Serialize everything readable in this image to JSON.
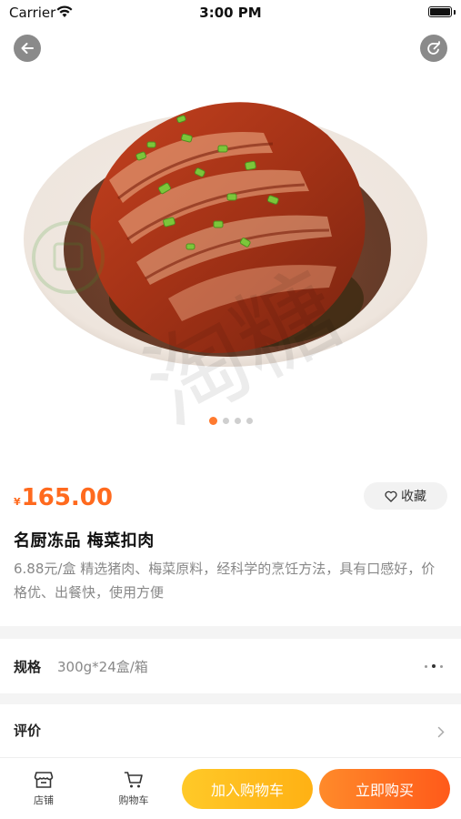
{
  "status_bar": {
    "carrier": "Carrier",
    "time": "3:00 PM",
    "battery_level": 1.0
  },
  "nav": {
    "back_icon": "arrow-left-icon",
    "share_icon": "share-icon"
  },
  "gallery": {
    "image": "braised-pork-with-preserved-vegetables",
    "page_count": 4,
    "active_index": 0,
    "watermark": "淘糖"
  },
  "product": {
    "currency": "¥",
    "price": "165.00",
    "favorite_label": "收藏",
    "title": "名厨冻品  梅菜扣肉",
    "description": "6.88元/盒  精选猪肉、梅菜原料，经科学的烹饪方法，具有口感好，价格优、出餐快，使用方便"
  },
  "spec": {
    "label": "规格",
    "value": "300g*24盒/箱"
  },
  "reviews": {
    "label": "评价"
  },
  "bottom_bar": {
    "store_label": "店铺",
    "cart_label": "购物车",
    "add_to_cart_label": "加入购物车",
    "buy_now_label": "立即购买"
  },
  "colors": {
    "accent": "#ff6a1e",
    "cart_button": "#ffbb1c",
    "buy_button": "#ff6f22",
    "muted_text": "#888888",
    "divider": "#f4f4f4"
  }
}
